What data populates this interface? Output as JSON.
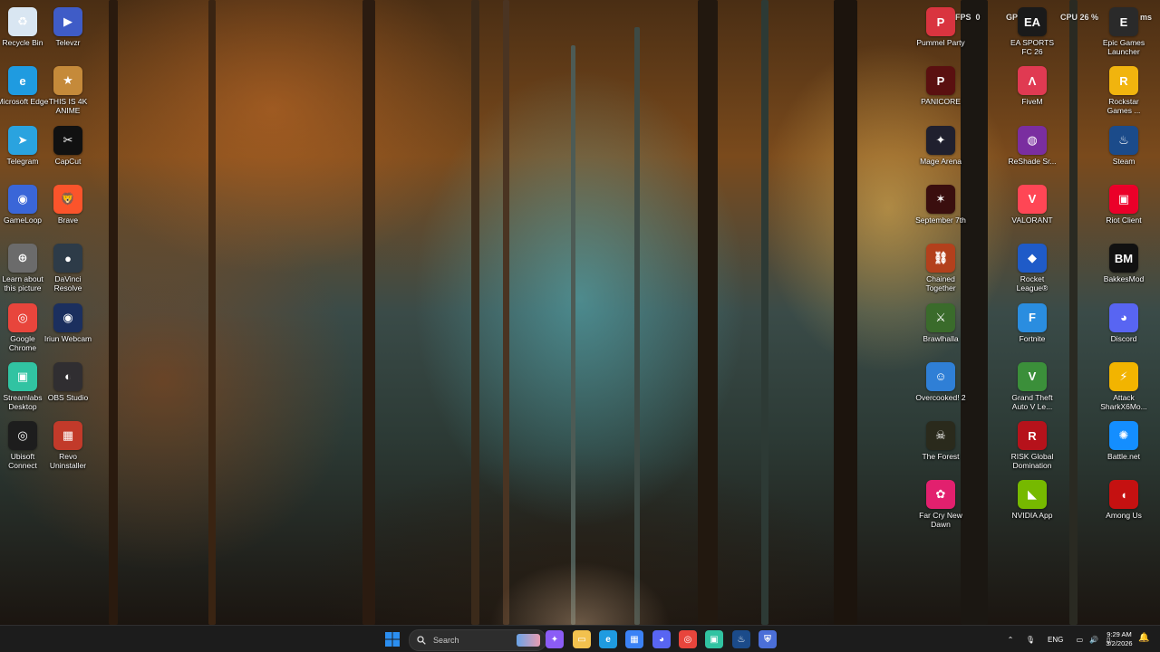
{
  "overlay": {
    "fps_label": "FPS",
    "fps_value": "0",
    "gpu_label": "GPU",
    "cpu_label": "CPU",
    "cpu_value": "26 %",
    "ms_label": "ms"
  },
  "desktop_left": [
    {
      "label": "Recycle Bin",
      "icon": "recycle-bin-icon",
      "glyph": "♻",
      "color": "#d9e6f2"
    },
    {
      "label": "Televzr",
      "icon": "televzr-icon",
      "glyph": "▶",
      "color": "#3f5cc7"
    },
    {
      "label": "Microsoft Edge",
      "icon": "edge-icon",
      "glyph": "e",
      "color": "#1f9be0"
    },
    {
      "label": "THIS IS 4K ANIME",
      "icon": "anime-icon",
      "glyph": "★",
      "color": "#c58a3a"
    },
    {
      "label": "Telegram",
      "icon": "telegram-icon",
      "glyph": "➤",
      "color": "#2aa3df"
    },
    {
      "label": "CapCut",
      "icon": "capcut-icon",
      "glyph": "✂",
      "color": "#111111"
    },
    {
      "label": "GameLoop",
      "icon": "gameloop-icon",
      "glyph": "◉",
      "color": "#3a66d8"
    },
    {
      "label": "Brave",
      "icon": "brave-icon",
      "glyph": "🦁",
      "color": "#fb542b"
    },
    {
      "label": "Learn about this picture",
      "icon": "learn-about-picture-icon",
      "glyph": "⊕",
      "color": "#6b6b6b"
    },
    {
      "label": "DaVinci Resolve",
      "icon": "davinci-resolve-icon",
      "glyph": "●",
      "color": "#2d3b48"
    },
    {
      "label": "Google Chrome",
      "icon": "chrome-icon",
      "glyph": "◎",
      "color": "#e8453c"
    },
    {
      "label": "Iriun Webcam",
      "icon": "iriun-webcam-icon",
      "glyph": "◉",
      "color": "#1b2f5e"
    },
    {
      "label": "Streamlabs Desktop",
      "icon": "streamlabs-icon",
      "glyph": "▣",
      "color": "#31c3a2"
    },
    {
      "label": "OBS Studio",
      "icon": "obs-studio-icon",
      "glyph": "◐",
      "color": "#302e31"
    },
    {
      "label": "Ubisoft Connect",
      "icon": "ubisoft-connect-icon",
      "glyph": "◎",
      "color": "#1d1d1d"
    },
    {
      "label": "Revo Uninstaller",
      "icon": "revo-uninstaller-icon",
      "glyph": "▦",
      "color": "#c23a2a"
    }
  ],
  "desktop_right": [
    {
      "label": "Pummel Party",
      "icon": "pummel-party-icon",
      "glyph": "P",
      "color": "#d9343f"
    },
    {
      "label": "EA SPORTS FC 26",
      "icon": "ea-sports-fc-icon",
      "glyph": "EA",
      "color": "#1a1a1a"
    },
    {
      "label": "Epic Games Launcher",
      "icon": "epic-games-icon",
      "glyph": "E",
      "color": "#2a2a2a"
    },
    {
      "label": "PANICORE",
      "icon": "panicore-icon",
      "glyph": "P",
      "color": "#5a1010"
    },
    {
      "label": "FiveM",
      "icon": "fivem-icon",
      "glyph": "Λ",
      "color": "#e03a52"
    },
    {
      "label": "Rockstar Games ...",
      "icon": "rockstar-games-icon",
      "glyph": "R",
      "color": "#f1b40e"
    },
    {
      "label": "Mage Arena",
      "icon": "mage-arena-icon",
      "glyph": "✦",
      "color": "#20202e"
    },
    {
      "label": "ReShade Sr...",
      "icon": "reshade-icon",
      "glyph": "◍",
      "color": "#7a2ea0"
    },
    {
      "label": "Steam",
      "icon": "steam-icon",
      "glyph": "♨",
      "color": "#1b4b8a"
    },
    {
      "label": "September 7th",
      "icon": "september-7th-icon",
      "glyph": "✶",
      "color": "#3a0e0e"
    },
    {
      "label": "VALORANT",
      "icon": "valorant-icon",
      "glyph": "V",
      "color": "#ff4655"
    },
    {
      "label": "Riot Client",
      "icon": "riot-client-icon",
      "glyph": "▣",
      "color": "#eb0029"
    },
    {
      "label": "Chained Together",
      "icon": "chained-together-icon",
      "glyph": "⛓",
      "color": "#b3401c"
    },
    {
      "label": "Rocket League®",
      "icon": "rocket-league-icon",
      "glyph": "◆",
      "color": "#1f5bc8"
    },
    {
      "label": "BakkesMod",
      "icon": "bakkesmod-icon",
      "glyph": "BM",
      "color": "#111111"
    },
    {
      "label": "Brawlhalla",
      "icon": "brawlhalla-icon",
      "glyph": "⚔",
      "color": "#3a6b2b"
    },
    {
      "label": "Fortnite",
      "icon": "fortnite-icon",
      "glyph": "F",
      "color": "#2a8de0"
    },
    {
      "label": "Discord",
      "icon": "discord-icon",
      "glyph": "◕",
      "color": "#5865f2"
    },
    {
      "label": "Overcooked! 2",
      "icon": "overcooked-icon",
      "glyph": "☺",
      "color": "#2f7fd6"
    },
    {
      "label": "Grand Theft Auto V Le...",
      "icon": "gta-v-icon",
      "glyph": "V",
      "color": "#3b8f3a"
    },
    {
      "label": "Attack SharkX6Mo...",
      "icon": "attack-shark-icon",
      "glyph": "⚡",
      "color": "#f2b400"
    },
    {
      "label": "The Forest",
      "icon": "the-forest-icon",
      "glyph": "☠",
      "color": "#2a2a1c"
    },
    {
      "label": "RISK Global Domination",
      "icon": "risk-icon",
      "glyph": "R",
      "color": "#b6121b"
    },
    {
      "label": "Battle.net",
      "icon": "battle-net-icon",
      "glyph": "✺",
      "color": "#148eff"
    },
    {
      "label": "Far Cry New Dawn",
      "icon": "far-cry-new-dawn-icon",
      "glyph": "✿",
      "color": "#e2206e"
    },
    {
      "label": "NVIDIA App",
      "icon": "nvidia-app-icon",
      "glyph": "◣",
      "color": "#76b900"
    },
    {
      "label": "Among Us",
      "icon": "among-us-icon",
      "glyph": "◖",
      "color": "#c51111"
    }
  ],
  "taskbar": {
    "search_placeholder": "Search",
    "pinned": [
      {
        "icon": "start-icon",
        "glyph": "⊞",
        "color": "#2b8ef0"
      },
      {
        "icon": "copilot-icon",
        "glyph": "✦",
        "color": "#8b5cf6"
      },
      {
        "icon": "file-explorer-icon",
        "glyph": "▭",
        "color": "#f2c14e"
      },
      {
        "icon": "edge-icon",
        "glyph": "e",
        "color": "#1f9be0"
      },
      {
        "icon": "microsoft-store-icon",
        "glyph": "▦",
        "color": "#3b82f6"
      },
      {
        "icon": "discord-icon",
        "glyph": "◕",
        "color": "#5865f2"
      },
      {
        "icon": "chrome-icon",
        "glyph": "◎",
        "color": "#e8453c"
      },
      {
        "icon": "streamlabs-icon",
        "glyph": "▣",
        "color": "#31c3a2"
      },
      {
        "icon": "steam-icon",
        "glyph": "♨",
        "color": "#1b4b8a"
      },
      {
        "icon": "vpn-shield-icon",
        "glyph": "⛨",
        "color": "#4b6fd8"
      }
    ],
    "tray": {
      "language": "ENG",
      "time": "9:29 AM",
      "date": "3/2/2026"
    }
  }
}
